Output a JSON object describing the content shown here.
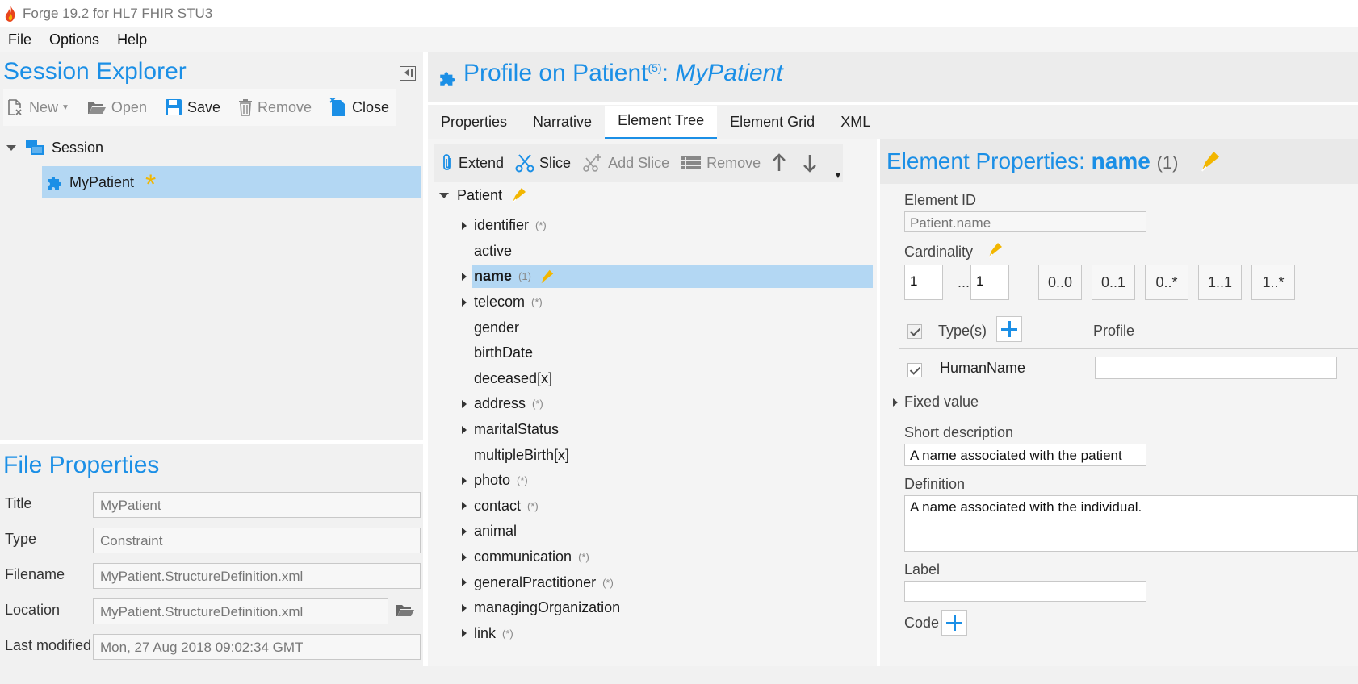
{
  "window": {
    "title": "Forge 19.2 for HL7 FHIR STU3"
  },
  "menu": [
    "File",
    "Options",
    "Help"
  ],
  "session_explorer": {
    "heading": "Session Explorer",
    "toolbar": {
      "new": "New",
      "open": "Open",
      "save": "Save",
      "remove": "Remove",
      "close": "Close"
    },
    "tree": {
      "root": "Session",
      "child": "MyPatient"
    }
  },
  "file_properties": {
    "heading": "File Properties",
    "rows": [
      {
        "label": "Title",
        "value": "MyPatient"
      },
      {
        "label": "Type",
        "value": "Constraint"
      },
      {
        "label": "Filename",
        "value": "MyPatient.StructureDefinition.xml"
      },
      {
        "label": "Location",
        "value": "MyPatient.StructureDefinition.xml"
      },
      {
        "label": "Last modified",
        "value": "Mon, 27 Aug 2018 09:02:34 GMT"
      }
    ]
  },
  "profile": {
    "title_prefix": "Profile on Patient",
    "sup": "(5)",
    "separator": ":",
    "name": "MyPatient"
  },
  "tabs": [
    "Properties",
    "Narrative",
    "Element Tree",
    "Element Grid",
    "XML"
  ],
  "tree_toolbar": {
    "extend": "Extend",
    "slice": "Slice",
    "add_slice": "Add Slice",
    "remove": "Remove"
  },
  "element_tree": {
    "root": "Patient",
    "nodes": [
      {
        "label": "identifier",
        "card": "(*)",
        "expandable": true
      },
      {
        "label": "active",
        "card": "",
        "expandable": false
      },
      {
        "label": "name",
        "card": "(1)",
        "expandable": true,
        "selected": true
      },
      {
        "label": "telecom",
        "card": "(*)",
        "expandable": true
      },
      {
        "label": "gender",
        "card": "",
        "expandable": false
      },
      {
        "label": "birthDate",
        "card": "",
        "expandable": false
      },
      {
        "label": "deceased[x]",
        "card": "",
        "expandable": false
      },
      {
        "label": "address",
        "card": "(*)",
        "expandable": true
      },
      {
        "label": "maritalStatus",
        "card": "",
        "expandable": true
      },
      {
        "label": "multipleBirth[x]",
        "card": "",
        "expandable": false
      },
      {
        "label": "photo",
        "card": "(*)",
        "expandable": true
      },
      {
        "label": "contact",
        "card": "(*)",
        "expandable": true
      },
      {
        "label": "animal",
        "card": "",
        "expandable": true
      },
      {
        "label": "communication",
        "card": "(*)",
        "expandable": true
      },
      {
        "label": "generalPractitioner",
        "card": "(*)",
        "expandable": true
      },
      {
        "label": "managingOrganization",
        "card": "",
        "expandable": true
      },
      {
        "label": "link",
        "card": "(*)",
        "expandable": true
      }
    ]
  },
  "element_properties": {
    "heading_prefix": "Element Properties:",
    "element_name": "name",
    "card": "(1)",
    "element_id_label": "Element ID",
    "element_id_value": "Patient.name",
    "cardinality_label": "Cardinality",
    "min": "1",
    "ellipsis": "...",
    "max": "1",
    "presets": [
      "0..0",
      "0..1",
      "0..*",
      "1..1",
      "1..*"
    ],
    "types_label": "Type(s)",
    "profile_label": "Profile",
    "type_row": "HumanName",
    "fixed_value_label": "Fixed value",
    "short_desc_label": "Short description",
    "short_desc_value": "A name associated with the patient",
    "definition_label": "Definition",
    "definition_value": "A name associated with the individual.",
    "label_label": "Label",
    "label_value": "",
    "code_label": "Code"
  },
  "colors": {
    "accent": "#1b8fe6",
    "selection": "#b3d7f3",
    "star": "#f2b600"
  }
}
